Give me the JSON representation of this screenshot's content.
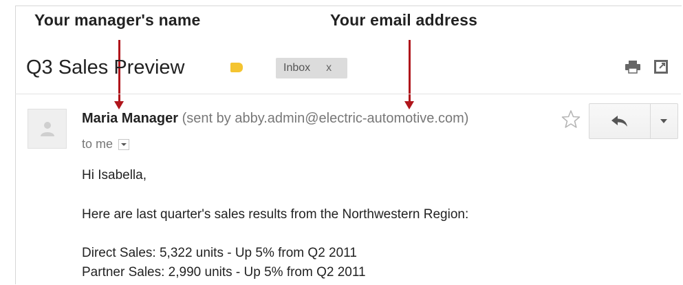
{
  "annotations": {
    "manager_name_label": "Your manager's name",
    "email_address_label": "Your email address"
  },
  "email": {
    "subject": "Q3 Sales Preview",
    "label_chip": "Inbox",
    "label_chip_close": "x",
    "sender_name": "Maria Manager",
    "sender_extra": "(sent by abby.admin@electric-automotive.com)",
    "to_line": "to me",
    "greeting": "Hi Isabella,",
    "intro": "Here are last quarter's sales results from the Northwestern Region:",
    "direct_sales": "Direct Sales: 5,322 units - Up 5% from Q2 2011",
    "partner_sales": "Partner Sales: 2,990 units - Up 5% from Q2 2011"
  },
  "colors": {
    "annotation_arrow": "#b0151b",
    "label_tag": "#f4c430",
    "chip_bg": "#dcdcdc"
  },
  "icons": {
    "label_tag": "label-tag-icon",
    "print": "print-icon",
    "new_window": "new-window-icon",
    "avatar": "person-icon",
    "star": "star-icon",
    "reply": "reply-icon",
    "more": "chevron-down-icon"
  }
}
